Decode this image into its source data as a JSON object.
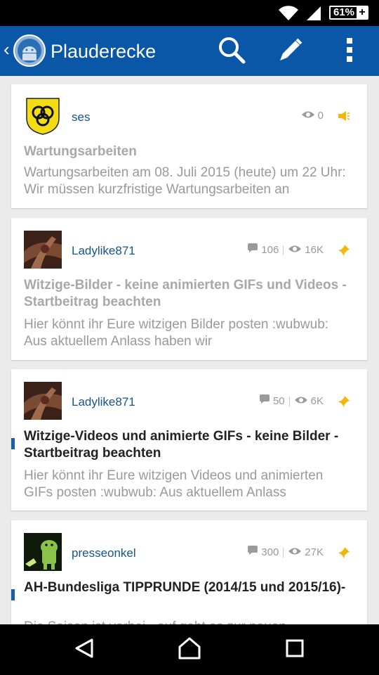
{
  "status_bar": {
    "battery_text": "61%",
    "icons": [
      "wifi-icon",
      "signal-icon",
      "battery-charging-icon"
    ]
  },
  "app_bar": {
    "title": "Plauderecke",
    "icons": [
      "back-chevron-icon",
      "app-logo-icon",
      "search-icon",
      "pencil-icon",
      "overflow-menu-icon"
    ]
  },
  "topics": [
    {
      "author": "ses",
      "views": "0",
      "flag_icon": "announcement-icon",
      "title": "Wartungsarbeiten",
      "excerpt": "Wartungsarbeiten am 08. Juli 2015 (heute) um 22 Uhr: Wir müssen kurzfristige Wartungsarbeiten an",
      "read": true
    },
    {
      "author": "Ladylike871",
      "replies": "106",
      "views": "16K",
      "flag_icon": "pin-icon",
      "title": "Witzige-Bilder -  keine animierten GIFs und Videos - Startbeitrag beachten",
      "excerpt": "Hier könnt ihr Eure witzigen Bilder posten :wubwub:  Aus aktuellem Anlass haben wir",
      "read": true
    },
    {
      "author": "Ladylike871",
      "replies": "50",
      "views": "6K",
      "flag_icon": "pin-icon",
      "title": "Witzige-Videos und  animierte GIFs - keine Bilder - Startbeitrag beachten",
      "excerpt": "Hier könnt ihr Eure witzigen Videos und animierten GIFs posten :wubwub:    Aus aktuellem Anlass",
      "read": false
    },
    {
      "author": "presseonkel",
      "replies": "300",
      "views": "27K",
      "flag_icon": "pin-icon",
      "title": "AH-Bundesliga TIPPRUNDE  (2014/15 und 2015/16)-",
      "excerpt": "Die Saison ist vorbei - auf geht es zur neuen",
      "read": false
    }
  ],
  "colors": {
    "app_bar": "#0957a6",
    "unread_indicator": "#1a5ea8",
    "pin": "#f2b70a",
    "author_link": "#14558f"
  },
  "nav_bar": {
    "icons": [
      "back-triangle-icon",
      "home-icon",
      "recents-icon"
    ]
  }
}
